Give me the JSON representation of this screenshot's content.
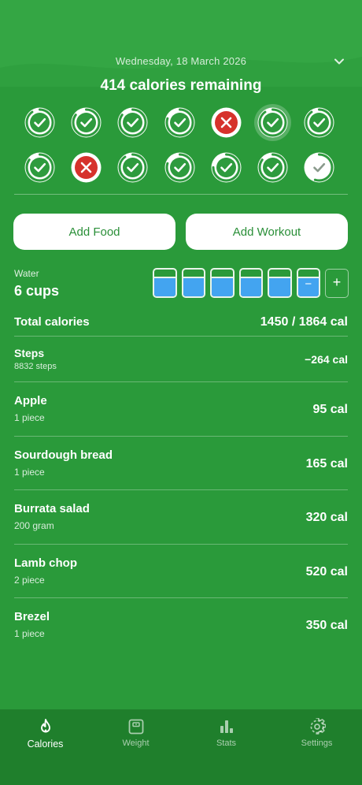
{
  "header": {
    "date": "Wednesday, 18 March 2026",
    "remaining": "414 calories remaining"
  },
  "days": [
    {
      "status": "done",
      "progress": 0.9
    },
    {
      "status": "done",
      "progress": 0.85
    },
    {
      "status": "done",
      "progress": 0.85
    },
    {
      "status": "done",
      "progress": 0.8
    },
    {
      "status": "over",
      "progress": 1.0
    },
    {
      "status": "done",
      "progress": 0.9,
      "selected": true
    },
    {
      "status": "done",
      "progress": 0.9
    },
    {
      "status": "done",
      "progress": 0.85
    },
    {
      "status": "over",
      "progress": 1.0
    },
    {
      "status": "done",
      "progress": 0.9
    },
    {
      "status": "done",
      "progress": 0.8
    },
    {
      "status": "done",
      "progress": 0.75
    },
    {
      "status": "done",
      "progress": 0.85
    },
    {
      "status": "partial",
      "progress": 0.55
    }
  ],
  "actions": {
    "add_food": "Add Food",
    "add_workout": "Add Workout"
  },
  "water": {
    "label": "Water",
    "value": "6 cups",
    "cups_filled": 6,
    "minus": "−",
    "plus": "+"
  },
  "totals": {
    "label": "Total calories",
    "value": "1450 / 1864 cal"
  },
  "steps": {
    "name": "Steps",
    "detail": "8832 steps",
    "cal": "−264 cal"
  },
  "foods": [
    {
      "name": "Apple",
      "detail": "1 piece",
      "cal": "95 cal"
    },
    {
      "name": "Sourdough bread",
      "detail": "1 piece",
      "cal": "165 cal"
    },
    {
      "name": "Burrata salad",
      "detail": "200 gram",
      "cal": "320 cal"
    },
    {
      "name": "Lamb chop",
      "detail": "2 piece",
      "cal": "520 cal"
    },
    {
      "name": "Brezel",
      "detail": "1 piece",
      "cal": "350 cal"
    }
  ],
  "tabs": [
    {
      "label": "Calories",
      "icon": "flame-icon",
      "active": true
    },
    {
      "label": "Weight",
      "icon": "scale-icon",
      "active": false
    },
    {
      "label": "Stats",
      "icon": "bar-chart-icon",
      "active": false
    },
    {
      "label": "Settings",
      "icon": "gear-icon",
      "active": false
    }
  ],
  "colors": {
    "background": "#2a9a3a",
    "tabbar": "#1f7f2c",
    "done": "#2e9b3e",
    "over": "#d6322c",
    "water": "#43a4f0"
  }
}
